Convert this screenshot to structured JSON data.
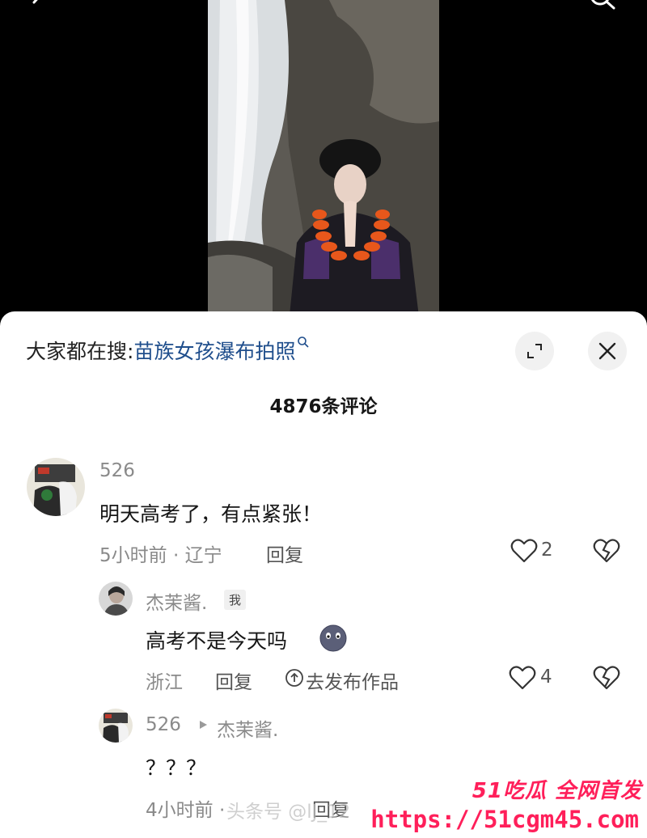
{
  "search_hint": {
    "prefix": "大家都在搜:",
    "keyword": "苗族女孩瀑布拍照"
  },
  "comments_title": "4876条评论",
  "comments": [
    {
      "author": "526",
      "text": "明天高考了，有点紧张！",
      "meta": "5小时前 · 辽宁",
      "reply_label": "回复",
      "likes": "2"
    }
  ],
  "replies": [
    {
      "author": "杰茉酱.",
      "badge": "我",
      "text": "高考不是今天吗",
      "meta": "浙江",
      "reply_label": "回复",
      "publish_label": "去发布作品",
      "likes": "4"
    },
    {
      "author": "526",
      "reply_to": "杰茉酱.",
      "text": "？？？",
      "meta": "4小时前 ·",
      "reply_label": "回复"
    }
  ],
  "watermark": {
    "brand": "51吃瓜 全网首发",
    "url": "https://51cgm45.com",
    "faint": "头条号 @lJ_12"
  },
  "colors": {
    "keyword": "#1f4e8c",
    "watermark": "#ff1f5a"
  }
}
